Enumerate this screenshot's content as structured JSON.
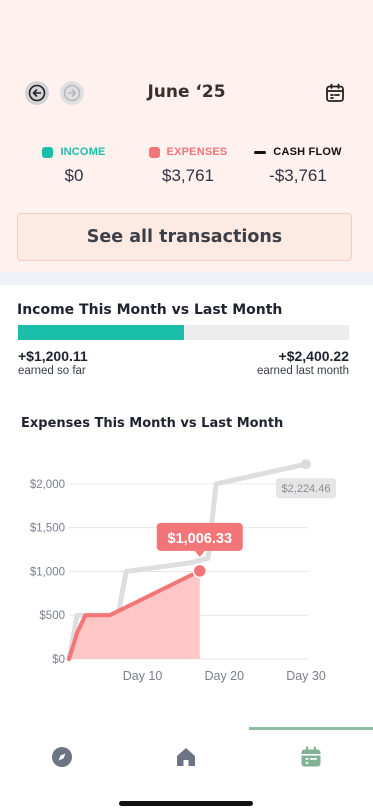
{
  "header": {
    "month": "June ‘25",
    "prev_icon": "arrow-left-icon",
    "next_icon": "arrow-right-icon",
    "calendar_icon": "calendar-icon"
  },
  "summary": {
    "income": {
      "label": "INCOME",
      "value": "$0",
      "color": "#1bbfa9"
    },
    "expenses": {
      "label": "EXPENSES",
      "value": "$3,761",
      "color": "#f27577"
    },
    "cash_flow": {
      "label": "CASH FLOW",
      "value": "-$3,761",
      "color": "#111111"
    }
  },
  "see_all_label": "See all transactions",
  "income_compare": {
    "title": "Income This Month vs Last Month",
    "progress_fraction": 0.5,
    "this_month_amount": "+$1,200.11",
    "this_month_caption": "earned so far",
    "last_month_amount": "+$2,400.22",
    "last_month_caption": "earned last month"
  },
  "expenses_compare": {
    "title": "Expenses This Month vs Last Month"
  },
  "chart_data": {
    "type": "line",
    "ylim": [
      0,
      2250
    ],
    "xlim": [
      1,
      30
    ],
    "y_ticks": [
      "$0",
      "$500",
      "$1,000",
      "$1,500",
      "$2,000"
    ],
    "y_tick_values": [
      0,
      500,
      1000,
      1500,
      2000
    ],
    "x_ticks": [
      "Day 10",
      "Day 20",
      "Day 30"
    ],
    "x_tick_values": [
      10,
      20,
      30
    ],
    "series": [
      {
        "color": "#dedede",
        "x": [
          1,
          2,
          3,
          5,
          7,
          8,
          16,
          18,
          19,
          30
        ],
        "y": [
          0,
          500,
          500,
          500,
          500,
          1000,
          1100,
          1150,
          2000,
          2224.46
        ],
        "end_label": "$2,224.46"
      },
      {
        "color": "#f27577",
        "fill": "#ffc6c6",
        "x": [
          1,
          2,
          3,
          6,
          17
        ],
        "y": [
          0,
          300,
          500,
          500,
          1006.33
        ],
        "end_label": "$1,006.33"
      }
    ]
  },
  "tabbar": {
    "items": [
      {
        "icon": "compass-icon",
        "active": false
      },
      {
        "icon": "home-icon",
        "active": false
      },
      {
        "icon": "calendar-icon",
        "active": true
      }
    ],
    "active_color": "#7fb394"
  }
}
